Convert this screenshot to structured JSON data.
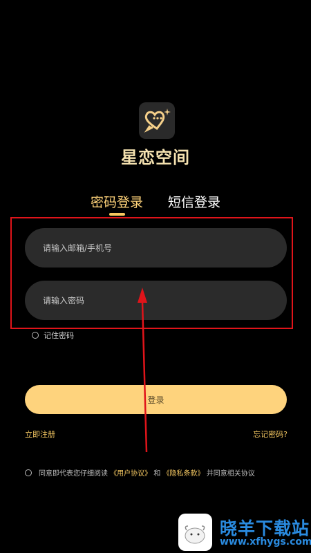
{
  "app": {
    "name": "星恋空间"
  },
  "tabs": {
    "password_label": "密码登录",
    "sms_label": "短信登录"
  },
  "form": {
    "account_placeholder": "请输入邮箱/手机号",
    "password_placeholder": "请输入密码",
    "remember_label": "记住密码",
    "login_label": "登录",
    "register_label": "立即注册",
    "forgot_label": "忘记密码?"
  },
  "agreement": {
    "prefix": "同意即代表您仔细阅读",
    "user_agreement": "《用户协议》",
    "and": "和",
    "privacy_policy": "《隐私条款》",
    "suffix": "并同意相关协议"
  },
  "watermark": {
    "title": "晓羊下载站",
    "url": "www.xfhygs.com"
  },
  "colors": {
    "accent": "#fed37d",
    "highlight": "#e0141a",
    "watermark": "#2a8be0"
  }
}
